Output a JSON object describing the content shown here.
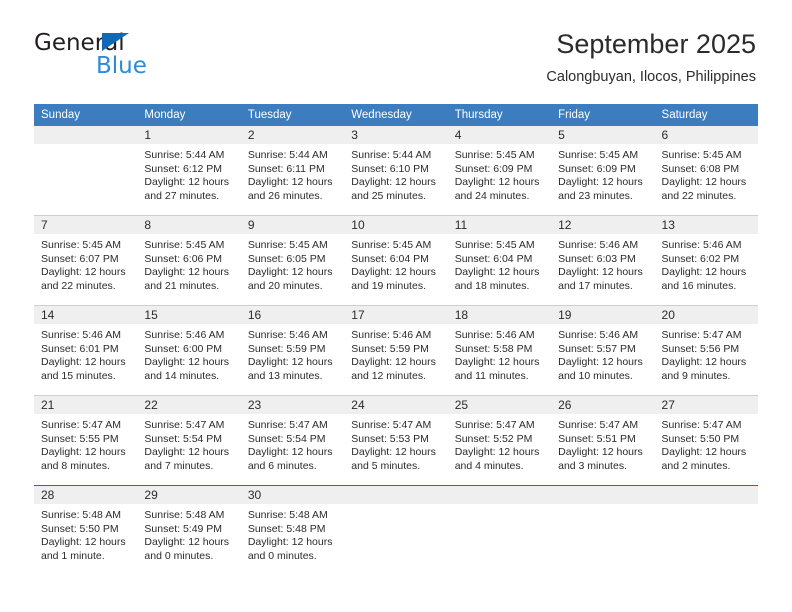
{
  "brand": {
    "name_part1": "General",
    "name_part2": "Blue",
    "logo_icon": "triangle-logo-icon"
  },
  "header": {
    "title": "September 2025",
    "subtitle": "Calongbuyan, Ilocos, Philippines"
  },
  "colors": {
    "header_blue": "#3b7dbf",
    "band_gray": "#efefef",
    "brand_dark": "#231f20",
    "brand_blue": "#2e8bd6",
    "row_divider": "#cfcfcf"
  },
  "weekdays": [
    "Sunday",
    "Monday",
    "Tuesday",
    "Wednesday",
    "Thursday",
    "Friday",
    "Saturday"
  ],
  "weeks": [
    [
      {
        "day": "",
        "blank": true,
        "sunrise": "",
        "sunset": "",
        "daylight1": "",
        "daylight2": ""
      },
      {
        "day": "1",
        "blank": false,
        "sunrise": "Sunrise: 5:44 AM",
        "sunset": "Sunset: 6:12 PM",
        "daylight1": "Daylight: 12 hours",
        "daylight2": "and 27 minutes."
      },
      {
        "day": "2",
        "blank": false,
        "sunrise": "Sunrise: 5:44 AM",
        "sunset": "Sunset: 6:11 PM",
        "daylight1": "Daylight: 12 hours",
        "daylight2": "and 26 minutes."
      },
      {
        "day": "3",
        "blank": false,
        "sunrise": "Sunrise: 5:44 AM",
        "sunset": "Sunset: 6:10 PM",
        "daylight1": "Daylight: 12 hours",
        "daylight2": "and 25 minutes."
      },
      {
        "day": "4",
        "blank": false,
        "sunrise": "Sunrise: 5:45 AM",
        "sunset": "Sunset: 6:09 PM",
        "daylight1": "Daylight: 12 hours",
        "daylight2": "and 24 minutes."
      },
      {
        "day": "5",
        "blank": false,
        "sunrise": "Sunrise: 5:45 AM",
        "sunset": "Sunset: 6:09 PM",
        "daylight1": "Daylight: 12 hours",
        "daylight2": "and 23 minutes."
      },
      {
        "day": "6",
        "blank": false,
        "sunrise": "Sunrise: 5:45 AM",
        "sunset": "Sunset: 6:08 PM",
        "daylight1": "Daylight: 12 hours",
        "daylight2": "and 22 minutes."
      }
    ],
    [
      {
        "day": "7",
        "blank": false,
        "sunrise": "Sunrise: 5:45 AM",
        "sunset": "Sunset: 6:07 PM",
        "daylight1": "Daylight: 12 hours",
        "daylight2": "and 22 minutes."
      },
      {
        "day": "8",
        "blank": false,
        "sunrise": "Sunrise: 5:45 AM",
        "sunset": "Sunset: 6:06 PM",
        "daylight1": "Daylight: 12 hours",
        "daylight2": "and 21 minutes."
      },
      {
        "day": "9",
        "blank": false,
        "sunrise": "Sunrise: 5:45 AM",
        "sunset": "Sunset: 6:05 PM",
        "daylight1": "Daylight: 12 hours",
        "daylight2": "and 20 minutes."
      },
      {
        "day": "10",
        "blank": false,
        "sunrise": "Sunrise: 5:45 AM",
        "sunset": "Sunset: 6:04 PM",
        "daylight1": "Daylight: 12 hours",
        "daylight2": "and 19 minutes."
      },
      {
        "day": "11",
        "blank": false,
        "sunrise": "Sunrise: 5:45 AM",
        "sunset": "Sunset: 6:04 PM",
        "daylight1": "Daylight: 12 hours",
        "daylight2": "and 18 minutes."
      },
      {
        "day": "12",
        "blank": false,
        "sunrise": "Sunrise: 5:46 AM",
        "sunset": "Sunset: 6:03 PM",
        "daylight1": "Daylight: 12 hours",
        "daylight2": "and 17 minutes."
      },
      {
        "day": "13",
        "blank": false,
        "sunrise": "Sunrise: 5:46 AM",
        "sunset": "Sunset: 6:02 PM",
        "daylight1": "Daylight: 12 hours",
        "daylight2": "and 16 minutes."
      }
    ],
    [
      {
        "day": "14",
        "blank": false,
        "sunrise": "Sunrise: 5:46 AM",
        "sunset": "Sunset: 6:01 PM",
        "daylight1": "Daylight: 12 hours",
        "daylight2": "and 15 minutes."
      },
      {
        "day": "15",
        "blank": false,
        "sunrise": "Sunrise: 5:46 AM",
        "sunset": "Sunset: 6:00 PM",
        "daylight1": "Daylight: 12 hours",
        "daylight2": "and 14 minutes."
      },
      {
        "day": "16",
        "blank": false,
        "sunrise": "Sunrise: 5:46 AM",
        "sunset": "Sunset: 5:59 PM",
        "daylight1": "Daylight: 12 hours",
        "daylight2": "and 13 minutes."
      },
      {
        "day": "17",
        "blank": false,
        "sunrise": "Sunrise: 5:46 AM",
        "sunset": "Sunset: 5:59 PM",
        "daylight1": "Daylight: 12 hours",
        "daylight2": "and 12 minutes."
      },
      {
        "day": "18",
        "blank": false,
        "sunrise": "Sunrise: 5:46 AM",
        "sunset": "Sunset: 5:58 PM",
        "daylight1": "Daylight: 12 hours",
        "daylight2": "and 11 minutes."
      },
      {
        "day": "19",
        "blank": false,
        "sunrise": "Sunrise: 5:46 AM",
        "sunset": "Sunset: 5:57 PM",
        "daylight1": "Daylight: 12 hours",
        "daylight2": "and 10 minutes."
      },
      {
        "day": "20",
        "blank": false,
        "sunrise": "Sunrise: 5:47 AM",
        "sunset": "Sunset: 5:56 PM",
        "daylight1": "Daylight: 12 hours",
        "daylight2": "and 9 minutes."
      }
    ],
    [
      {
        "day": "21",
        "blank": false,
        "sunrise": "Sunrise: 5:47 AM",
        "sunset": "Sunset: 5:55 PM",
        "daylight1": "Daylight: 12 hours",
        "daylight2": "and 8 minutes."
      },
      {
        "day": "22",
        "blank": false,
        "sunrise": "Sunrise: 5:47 AM",
        "sunset": "Sunset: 5:54 PM",
        "daylight1": "Daylight: 12 hours",
        "daylight2": "and 7 minutes."
      },
      {
        "day": "23",
        "blank": false,
        "sunrise": "Sunrise: 5:47 AM",
        "sunset": "Sunset: 5:54 PM",
        "daylight1": "Daylight: 12 hours",
        "daylight2": "and 6 minutes."
      },
      {
        "day": "24",
        "blank": false,
        "sunrise": "Sunrise: 5:47 AM",
        "sunset": "Sunset: 5:53 PM",
        "daylight1": "Daylight: 12 hours",
        "daylight2": "and 5 minutes."
      },
      {
        "day": "25",
        "blank": false,
        "sunrise": "Sunrise: 5:47 AM",
        "sunset": "Sunset: 5:52 PM",
        "daylight1": "Daylight: 12 hours",
        "daylight2": "and 4 minutes."
      },
      {
        "day": "26",
        "blank": false,
        "sunrise": "Sunrise: 5:47 AM",
        "sunset": "Sunset: 5:51 PM",
        "daylight1": "Daylight: 12 hours",
        "daylight2": "and 3 minutes."
      },
      {
        "day": "27",
        "blank": false,
        "sunrise": "Sunrise: 5:47 AM",
        "sunset": "Sunset: 5:50 PM",
        "daylight1": "Daylight: 12 hours",
        "daylight2": "and 2 minutes."
      }
    ],
    [
      {
        "day": "28",
        "blank": false,
        "sunrise": "Sunrise: 5:48 AM",
        "sunset": "Sunset: 5:50 PM",
        "daylight1": "Daylight: 12 hours",
        "daylight2": "and 1 minute."
      },
      {
        "day": "29",
        "blank": false,
        "sunrise": "Sunrise: 5:48 AM",
        "sunset": "Sunset: 5:49 PM",
        "daylight1": "Daylight: 12 hours",
        "daylight2": "and 0 minutes."
      },
      {
        "day": "30",
        "blank": false,
        "sunrise": "Sunrise: 5:48 AM",
        "sunset": "Sunset: 5:48 PM",
        "daylight1": "Daylight: 12 hours",
        "daylight2": "and 0 minutes."
      },
      {
        "day": "",
        "blank": true,
        "sunrise": "",
        "sunset": "",
        "daylight1": "",
        "daylight2": ""
      },
      {
        "day": "",
        "blank": true,
        "sunrise": "",
        "sunset": "",
        "daylight1": "",
        "daylight2": ""
      },
      {
        "day": "",
        "blank": true,
        "sunrise": "",
        "sunset": "",
        "daylight1": "",
        "daylight2": ""
      },
      {
        "day": "",
        "blank": true,
        "sunrise": "",
        "sunset": "",
        "daylight1": "",
        "daylight2": ""
      }
    ]
  ]
}
